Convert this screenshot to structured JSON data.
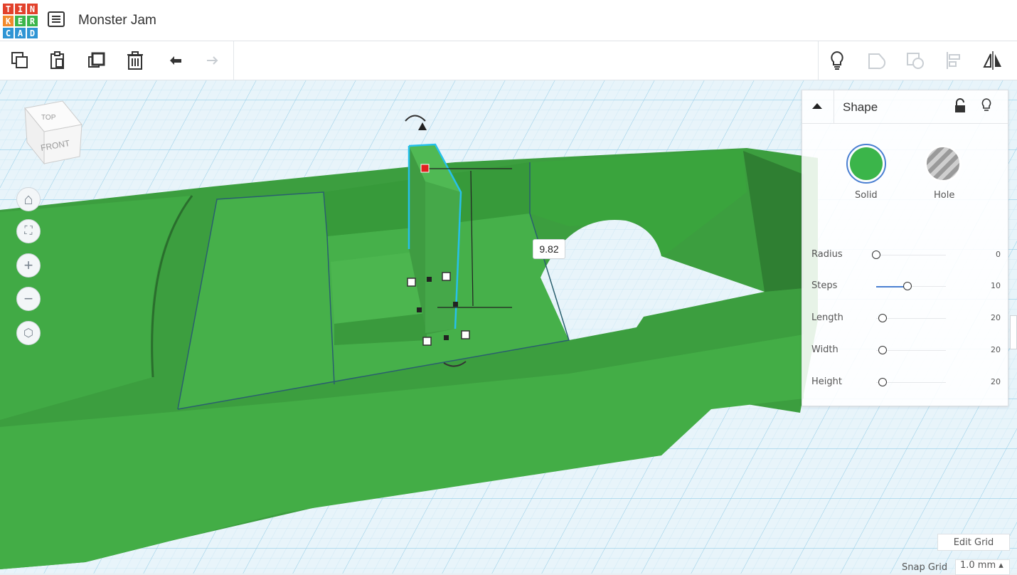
{
  "app": {
    "logo_letters": [
      "T",
      "I",
      "N",
      "K",
      "E",
      "R",
      "C",
      "A",
      "D"
    ],
    "logo_colors": [
      "#e2412b",
      "#e2412b",
      "#e2412b",
      "#f2892b",
      "#3bb54a",
      "#3bb54a",
      "#2f95d4",
      "#2f95d4",
      "#2f95d4"
    ],
    "project_title": "Monster Jam"
  },
  "toolbar": {
    "left_icons": [
      "copy-icon",
      "paste-icon",
      "duplicate-icon",
      "delete-icon",
      "undo-icon",
      "redo-icon"
    ],
    "right_icons": [
      "lightbulb-icon",
      "group-icon",
      "ungroup-icon",
      "align-icon",
      "mirror-icon"
    ]
  },
  "viewcube": {
    "top_label": "TOP",
    "front_label": "FRONT"
  },
  "nav": {
    "icons": [
      "home-icon",
      "fit-view-icon",
      "zoom-in-icon",
      "zoom-out-icon",
      "perspective-icon"
    ]
  },
  "dimension_label": "9.82",
  "shape_panel": {
    "title": "Shape",
    "solid_label": "Solid",
    "hole_label": "Hole",
    "accent_color": "#4a7fd1",
    "solid_color": "#3bb54a",
    "params": [
      {
        "name": "Radius",
        "value": "0",
        "fraction": 0.0
      },
      {
        "name": "Steps",
        "value": "10",
        "fraction": 0.45
      },
      {
        "name": "Length",
        "value": "20",
        "fraction": 0.09
      },
      {
        "name": "Width",
        "value": "20",
        "fraction": 0.09
      },
      {
        "name": "Height",
        "value": "20",
        "fraction": 0.09
      }
    ]
  },
  "footer": {
    "edit_grid_label": "Edit Grid",
    "snap_grid_label": "Snap Grid",
    "snap_grid_value": "1.0 mm ▴"
  }
}
